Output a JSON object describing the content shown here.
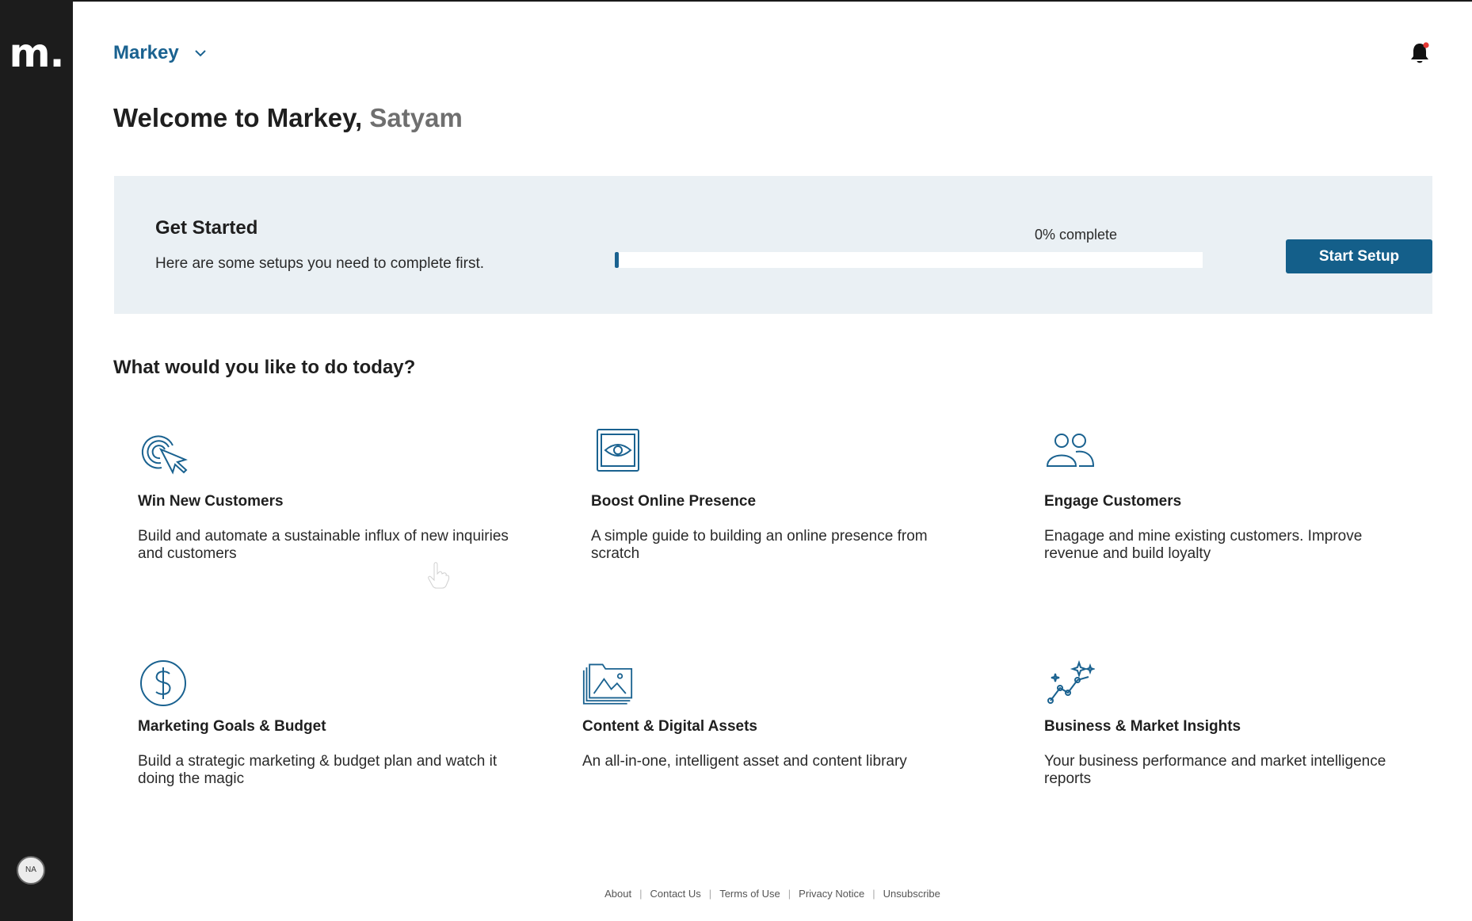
{
  "brand": {
    "logo_text": "m.",
    "accent": "#1a6290",
    "button_color": "#145f8a"
  },
  "header": {
    "org_name": "Markey",
    "org_chevron_icon": "chevron-down-icon",
    "notification_icon": "bell-icon",
    "notification_dot_color": "#e53935"
  },
  "sidebar": {
    "avatar_initials": "NA"
  },
  "welcome": {
    "prefix": "Welcome to Markey, ",
    "user_name": "Satyam"
  },
  "get_started": {
    "title": "Get Started",
    "subtitle": "Here are some setups you need to complete first.",
    "progress_label": "0% complete",
    "progress_value": 0,
    "button_label": "Start Setup"
  },
  "section_title": "What would you like to do today?",
  "cards": [
    {
      "icon": "cursor-click-icon",
      "title": "Win New Customers",
      "description": "Build and automate a sustainable influx of new inquiries and customers"
    },
    {
      "icon": "eye-window-icon",
      "title": "Boost Online Presence",
      "description": "A simple guide to building an online presence from scratch"
    },
    {
      "icon": "users-icon",
      "title": "Engage Customers",
      "description": "Enagage and mine existing customers. Improve revenue and build loyalty"
    },
    {
      "icon": "dollar-circle-icon",
      "title": "Marketing Goals & Budget",
      "description": "Build a strategic marketing & budget plan and watch it doing the magic"
    },
    {
      "icon": "image-folder-icon",
      "title": "Content & Digital Assets",
      "description": "An all-in-one, intelligent asset and content library"
    },
    {
      "icon": "sparkle-chart-icon",
      "title": "Business & Market Insights",
      "description": "Your business performance and market intelligence reports"
    }
  ],
  "footer": {
    "links": [
      "About",
      "Contact Us",
      "Terms of Use",
      "Privacy Notice",
      "Unsubscribe"
    ]
  }
}
